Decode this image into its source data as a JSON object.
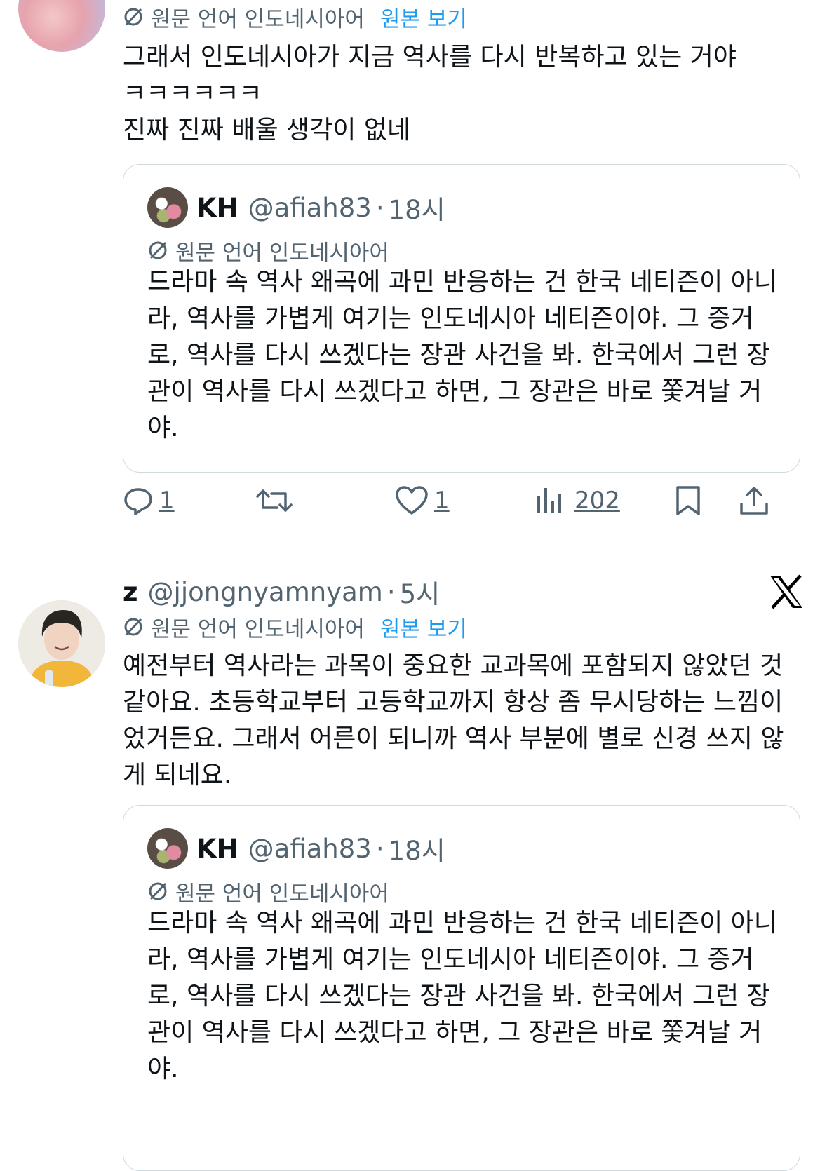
{
  "tweet1": {
    "translation_note": "원문 언어 인도네시아어",
    "show_original": "원본 보기",
    "text_lines": [
      "그래서 인도네시아가 지금 역사를 다시 반복하고 있는 거야",
      "ㅋㅋㅋㅋㅋㅋ",
      "진짜 진짜 배울 생각이 없네"
    ],
    "quote": {
      "name": "KH",
      "handle": "@afiah83",
      "dot": "·",
      "time": "18시",
      "translation_note": "원문 언어 인도네시아어",
      "text": "드라마 속 역사 왜곡에 과민 반응하는 건 한국 네티즌이 아니라, 역사를 가볍게 여기는 인도네시아 네티즌이야. 그 증거로, 역사를 다시 쓰겠다는 장관 사건을 봐. 한국에서 그런 장관이 역사를 다시 쓰겠다고 하면, 그 장관은 바로 쫓겨날 거야."
    },
    "actions": {
      "reply_count": "1",
      "like_count": "1",
      "view_count": "202"
    }
  },
  "tweet2": {
    "name": "z",
    "handle": "@jjongnyamnyam",
    "dot": "·",
    "time": "5시",
    "translation_note": "원문 언어 인도네시아어",
    "show_original": "원본 보기",
    "text": "예전부터 역사라는 과목이 중요한 교과목에 포함되지 않았던 것 같아요. 초등학교부터 고등학교까지 항상 좀 무시당하는 느낌이었거든요. 그래서 어른이 되니까 역사 부분에 별로 신경 쓰지 않게 되네요.",
    "quote": {
      "name": "KH",
      "handle": "@afiah83",
      "dot": "·",
      "time": "18시",
      "translation_note": "원문 언어 인도네시아어",
      "text": "드라마 속 역사 왜곡에 과민 반응하는 건 한국 네티즌이 아니라, 역사를 가볍게 여기는 인도네시아 네티즌이야. 그 증거로, 역사를 다시 쓰겠다는 장관 사건을 봐. 한국에서 그런 장관이 역사를 다시 쓰겠다고 하면, 그 장관은 바로 쫓겨날 거야."
    }
  },
  "icons": [
    "translate-icon",
    "reply-icon",
    "retweet-icon",
    "like-icon",
    "views-icon",
    "bookmark-icon",
    "share-icon",
    "x-logo-icon"
  ],
  "colors": {
    "link": "#1d9bf0",
    "muted": "#536471",
    "text": "#0f1419",
    "border": "#cfd9de"
  }
}
